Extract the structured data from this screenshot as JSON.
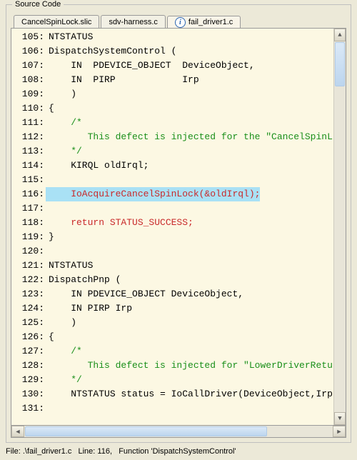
{
  "panel": {
    "title": "Source Code"
  },
  "tabs": [
    {
      "label": "CancelSpinLock.slic",
      "active": false
    },
    {
      "label": "sdv-harness.c",
      "active": false
    },
    {
      "label": "fail_driver1.c",
      "active": true,
      "icon": "info"
    }
  ],
  "code": {
    "highlight_line": 116,
    "lines": [
      {
        "n": 105,
        "spans": [
          [
            "",
            "NTSTATUS"
          ]
        ]
      },
      {
        "n": 106,
        "spans": [
          [
            "",
            "DispatchSystemControl ("
          ]
        ]
      },
      {
        "n": 107,
        "spans": [
          [
            "",
            "    IN  PDEVICE_OBJECT  DeviceObject,"
          ]
        ]
      },
      {
        "n": 108,
        "spans": [
          [
            "",
            "    IN  PIRP            Irp"
          ]
        ]
      },
      {
        "n": 109,
        "spans": [
          [
            "",
            "    )"
          ]
        ]
      },
      {
        "n": 110,
        "spans": [
          [
            "",
            "{"
          ]
        ]
      },
      {
        "n": 111,
        "spans": [
          [
            "cm",
            "    /*"
          ]
        ]
      },
      {
        "n": 112,
        "spans": [
          [
            "cm",
            "       This defect is injected for the \"CancelSpinL"
          ]
        ]
      },
      {
        "n": 113,
        "spans": [
          [
            "cm",
            "    */"
          ]
        ]
      },
      {
        "n": 114,
        "spans": [
          [
            "",
            "    KIRQL oldIrql;"
          ]
        ]
      },
      {
        "n": 115,
        "spans": [
          [
            "",
            ""
          ]
        ]
      },
      {
        "n": 116,
        "spans": [
          [
            "kw",
            "    IoAcquireCancelSpinLock(&oldIrql);"
          ]
        ]
      },
      {
        "n": 117,
        "spans": [
          [
            "",
            ""
          ]
        ]
      },
      {
        "n": 118,
        "spans": [
          [
            "kw",
            "    return STATUS_SUCCESS;"
          ]
        ]
      },
      {
        "n": 119,
        "spans": [
          [
            "",
            "}"
          ]
        ]
      },
      {
        "n": 120,
        "spans": [
          [
            "",
            ""
          ]
        ]
      },
      {
        "n": 121,
        "spans": [
          [
            "",
            "NTSTATUS"
          ]
        ]
      },
      {
        "n": 122,
        "spans": [
          [
            "",
            "DispatchPnp ("
          ]
        ]
      },
      {
        "n": 123,
        "spans": [
          [
            "",
            "    IN PDEVICE_OBJECT DeviceObject,"
          ]
        ]
      },
      {
        "n": 124,
        "spans": [
          [
            "",
            "    IN PIRP Irp"
          ]
        ]
      },
      {
        "n": 125,
        "spans": [
          [
            "",
            "    )"
          ]
        ]
      },
      {
        "n": 126,
        "spans": [
          [
            "",
            "{"
          ]
        ]
      },
      {
        "n": 127,
        "spans": [
          [
            "cm",
            "    /*"
          ]
        ]
      },
      {
        "n": 128,
        "spans": [
          [
            "cm",
            "       This defect is injected for \"LowerDriverRetu"
          ]
        ]
      },
      {
        "n": 129,
        "spans": [
          [
            "cm",
            "    */"
          ]
        ]
      },
      {
        "n": 130,
        "spans": [
          [
            "",
            "    NTSTATUS status = IoCallDriver(DeviceObject,Irp"
          ]
        ]
      },
      {
        "n": 131,
        "spans": [
          [
            "",
            ""
          ]
        ]
      }
    ]
  },
  "status": {
    "file_label": "File:",
    "file": ".\\fail_driver1.c",
    "line_label": "Line:",
    "line": "116",
    "func_label": "Function",
    "func": "DispatchSystemControl"
  }
}
